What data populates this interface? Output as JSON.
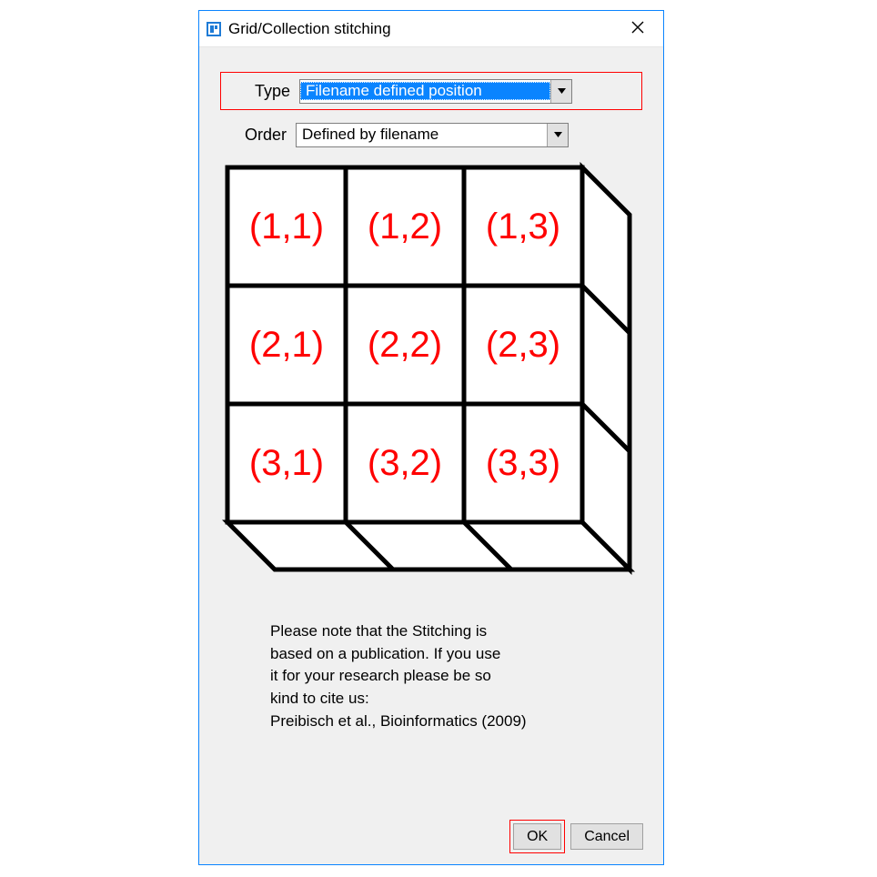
{
  "window": {
    "title": "Grid/Collection stitching"
  },
  "form": {
    "type_label": "Type",
    "type_value": "Filename defined position",
    "order_label": "Order",
    "order_value": "Defined by filename"
  },
  "grid": {
    "cells": [
      [
        "(1,1)",
        "(1,2)",
        "(1,3)"
      ],
      [
        "(2,1)",
        "(2,2)",
        "(2,3)"
      ],
      [
        "(3,1)",
        "(3,2)",
        "(3,3)"
      ]
    ]
  },
  "note": {
    "line1": "Please note that the Stitching is",
    "line2": "based on a publication. If you use",
    "line3": "it for your research please be so",
    "line4": "kind to cite us:",
    "line5": "Preibisch et al., Bioinformatics (2009)"
  },
  "buttons": {
    "ok": "OK",
    "cancel": "Cancel"
  }
}
